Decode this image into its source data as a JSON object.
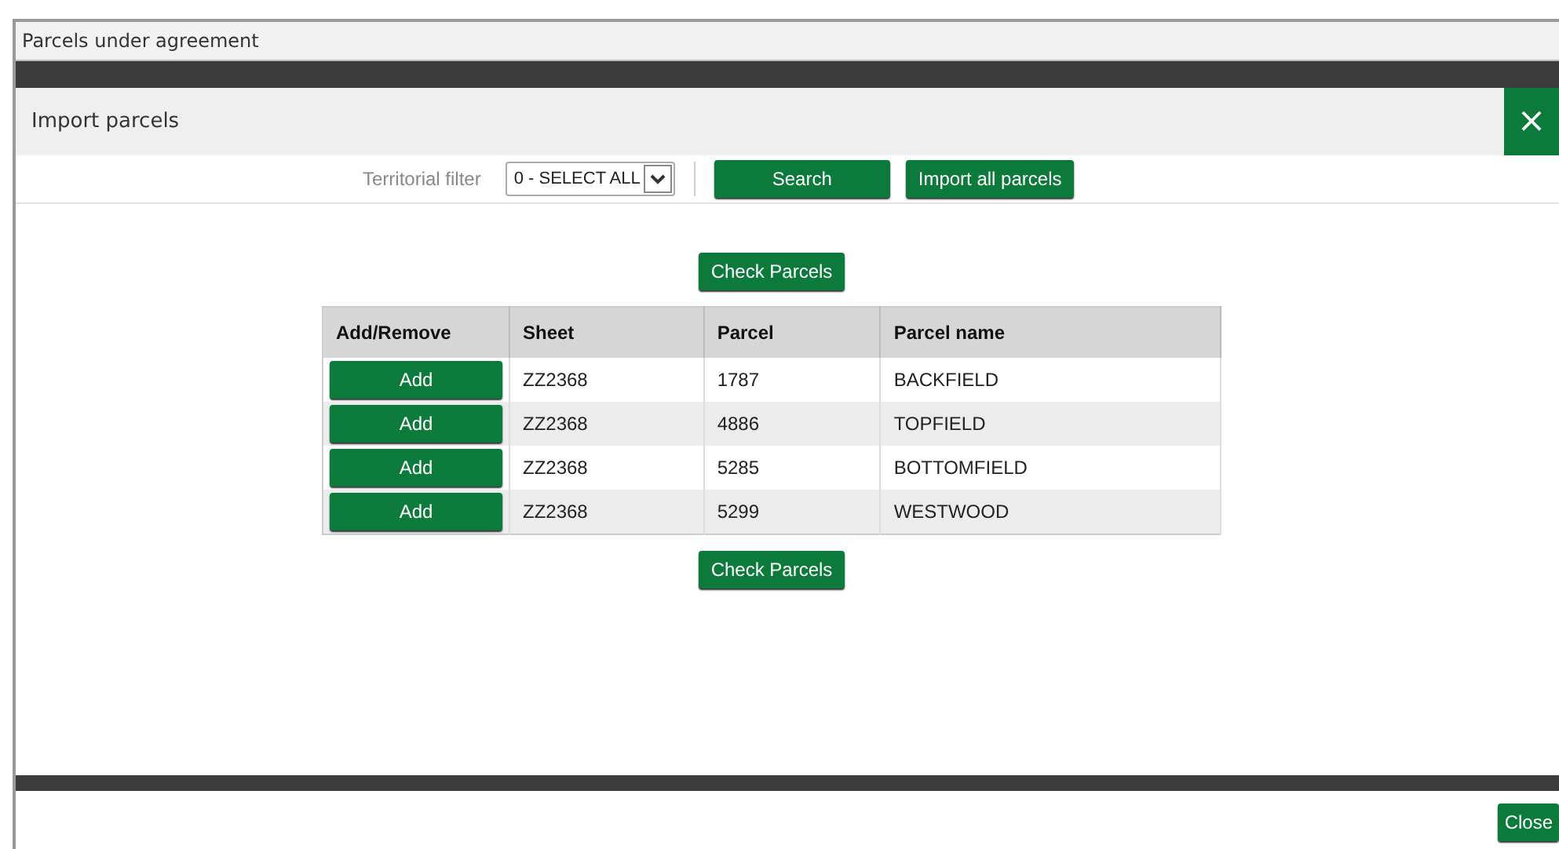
{
  "window": {
    "title": "Parcels under agreement"
  },
  "dialog": {
    "title": "Import parcels",
    "close_icon": "×"
  },
  "filter": {
    "label": "Territorial filter",
    "value": "0 - SELECT ALL"
  },
  "toolbar_buttons": [
    "Search",
    "Import all parcels"
  ],
  "check_buttons": [
    "Check Parcels",
    "Check Parcels"
  ],
  "table": {
    "columns": [
      "Add/Remove",
      "Sheet",
      "Parcel",
      "Parcel name"
    ],
    "rows": [
      {
        "action": "Add",
        "sheet": "ZZ2368",
        "parcel": "1787",
        "name": "BACKFIELD"
      },
      {
        "action": "Add",
        "sheet": "ZZ2368",
        "parcel": "4886",
        "name": "TOPFIELD"
      },
      {
        "action": "Add",
        "sheet": "ZZ2368",
        "parcel": "5285",
        "name": "BOTTOMFIELD"
      },
      {
        "action": "Add",
        "sheet": "ZZ2368",
        "parcel": "5299",
        "name": "WESTWOOD"
      }
    ]
  },
  "footer": {
    "button": "Close"
  }
}
